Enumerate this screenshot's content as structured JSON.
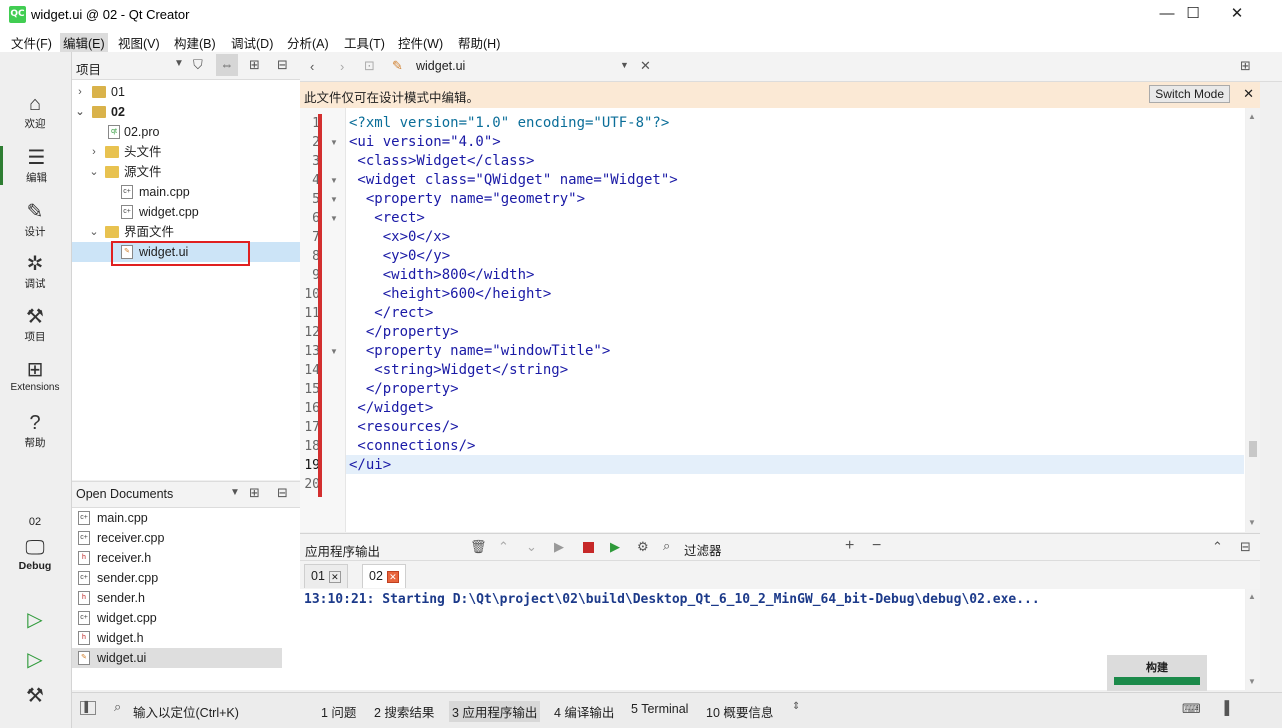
{
  "window": {
    "title": "widget.ui @ 02 - Qt Creator",
    "logo": "QC",
    "minimize": "—",
    "maximize": "☐",
    "close": "✕"
  },
  "menu": [
    "文件(F)",
    "编辑(E)",
    "视图(V)",
    "构建(B)",
    "调试(D)",
    "分析(A)",
    "工具(T)",
    "控件(W)",
    "帮助(H)"
  ],
  "modes": [
    {
      "label": "欢迎",
      "icon": "home-icon"
    },
    {
      "label": "编辑",
      "icon": "edit-icon"
    },
    {
      "label": "设计",
      "icon": "design-icon"
    },
    {
      "label": "调试",
      "icon": "bug-icon"
    },
    {
      "label": "项目",
      "icon": "wrench-icon"
    },
    {
      "label": "Extensions",
      "icon": "extensions-icon"
    },
    {
      "label": "帮助",
      "icon": "help-icon"
    }
  ],
  "kit": {
    "project": "02",
    "config": "Debug"
  },
  "project_panel": {
    "title": "项目"
  },
  "tree": {
    "p01": "01",
    "p02": "02",
    "pro": "02.pro",
    "headers": "头文件",
    "sources": "源文件",
    "main_cpp": "main.cpp",
    "widget_cpp": "widget.cpp",
    "forms": "界面文件",
    "widget_ui": "widget.ui"
  },
  "open_docs": {
    "title": "Open Documents",
    "items": [
      "main.cpp",
      "receiver.cpp",
      "receiver.h",
      "sender.cpp",
      "sender.h",
      "widget.cpp",
      "widget.h",
      "widget.ui"
    ]
  },
  "editor": {
    "file": "widget.ui",
    "info": "此文件仅可在设计模式中编辑。",
    "switch_mode": "Switch Mode",
    "lines": [
      "<?xml version=\"1.0\" encoding=\"UTF-8\"?>",
      "<ui version=\"4.0\">",
      " <class>Widget</class>",
      " <widget class=\"QWidget\" name=\"Widget\">",
      "  <property name=\"geometry\">",
      "   <rect>",
      "    <x>0</x>",
      "    <y>0</y>",
      "    <width>800</width>",
      "    <height>600</height>",
      "   </rect>",
      "  </property>",
      "  <property name=\"windowTitle\">",
      "   <string>Widget</string>",
      "  </property>",
      " </widget>",
      " <resources/>",
      " <connections/>",
      "</ui>",
      ""
    ]
  },
  "output": {
    "title": "应用程序输出",
    "filter": "过滤器",
    "tabs": [
      "01",
      "02"
    ],
    "text": "13:10:21: Starting D:\\Qt\\project\\02\\build\\Desktop_Qt_6_10_2_MinGW_64_bit-Debug\\debug\\02.exe...",
    "build_label": "构建"
  },
  "status": {
    "locate": "输入以定位(Ctrl+K)",
    "panes": [
      "1 问题",
      "2 搜索结果",
      "3 应用程序输出",
      "4 编译输出",
      "5 Terminal",
      "10 概要信息"
    ]
  },
  "colors": {
    "accent": "#2e7d32",
    "highlight": "#e02020",
    "infobar": "#fbe9d5",
    "output_text": "#1c3a8a"
  }
}
